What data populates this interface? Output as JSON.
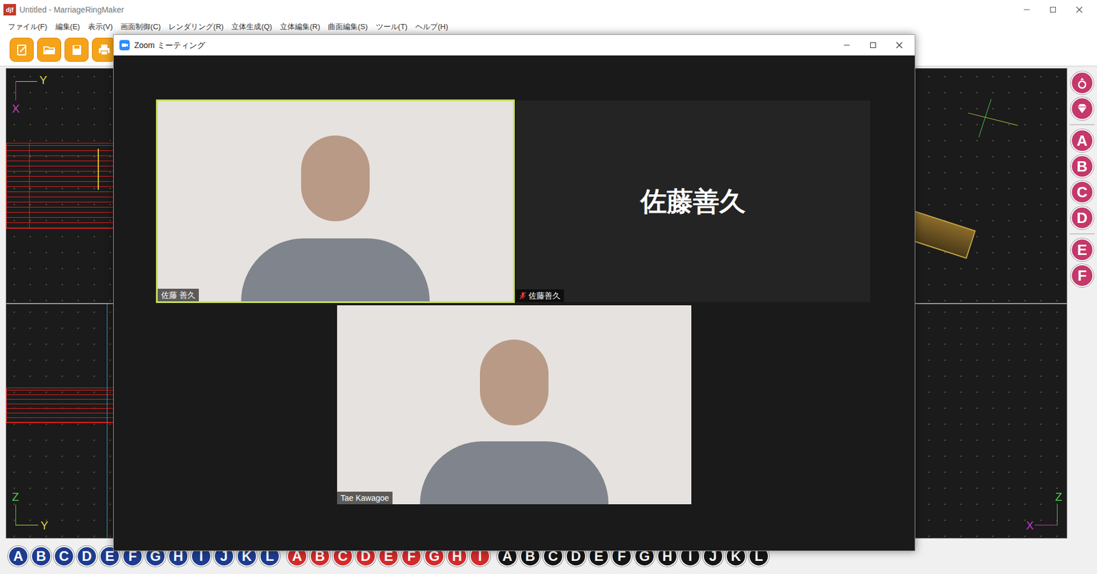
{
  "app": {
    "title": "Untitled - MarriageRingMaker",
    "logo": "djf"
  },
  "menu": [
    "ファイル(F)",
    "編集(E)",
    "表示(V)",
    "画面制御(C)",
    "レンダリング(R)",
    "立体生成(Q)",
    "立体編集(R)",
    "曲面編集(S)",
    "ツール(T)",
    "ヘルプ(H)"
  ],
  "axis_labels": {
    "top_left": [
      "Y",
      "X"
    ],
    "bottom_left": [
      "Z",
      "Y"
    ],
    "bottom_right": [
      "Z",
      "X"
    ]
  },
  "side_tools": [
    "A",
    "B",
    "C",
    "D",
    "E",
    "F"
  ],
  "key_groups": [
    {
      "color": "#1d3c8f",
      "keys": [
        "A",
        "B",
        "C",
        "D",
        "E",
        "F",
        "G",
        "H",
        "I",
        "J",
        "K",
        "L"
      ]
    },
    {
      "color": "#d42a2a",
      "keys": [
        "A",
        "B",
        "C",
        "D",
        "E",
        "F",
        "G",
        "H",
        "I"
      ]
    },
    {
      "color": "#151515",
      "keys": [
        "A",
        "B",
        "C",
        "D",
        "E",
        "F",
        "G",
        "H",
        "I",
        "J",
        "K",
        "L"
      ]
    }
  ],
  "zoom": {
    "title": "Zoom ミーティング",
    "tiles": [
      {
        "name": "佐藤 善久",
        "kind": "video",
        "speaking": true,
        "muted": false
      },
      {
        "name": "佐藤善久",
        "kind": "avatar",
        "display": "佐藤善久",
        "speaking": false,
        "muted": true
      },
      {
        "name": "Tae Kawagoe",
        "kind": "video",
        "speaking": false,
        "muted": false
      }
    ]
  }
}
